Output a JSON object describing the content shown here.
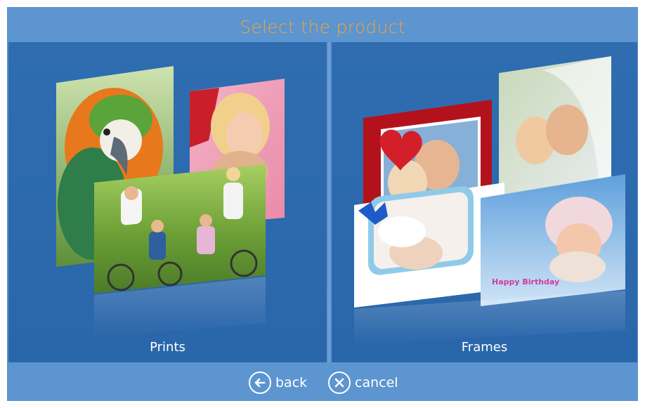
{
  "title": "Select the product",
  "products": [
    {
      "label": "Prints",
      "icon": "prints-collage-icon"
    },
    {
      "label": "Frames",
      "icon": "frames-collage-icon"
    }
  ],
  "footer": {
    "back_label": "back",
    "back_icon": "arrow-left-circle-icon",
    "cancel_label": "cancel",
    "cancel_icon": "x-circle-icon"
  },
  "decoration": {
    "frame_text": "Happy Birthday"
  },
  "colors": {
    "background": "#5c95cf",
    "panel": "#2f6db0",
    "title": "#f0a23c",
    "text": "#ffffff"
  }
}
